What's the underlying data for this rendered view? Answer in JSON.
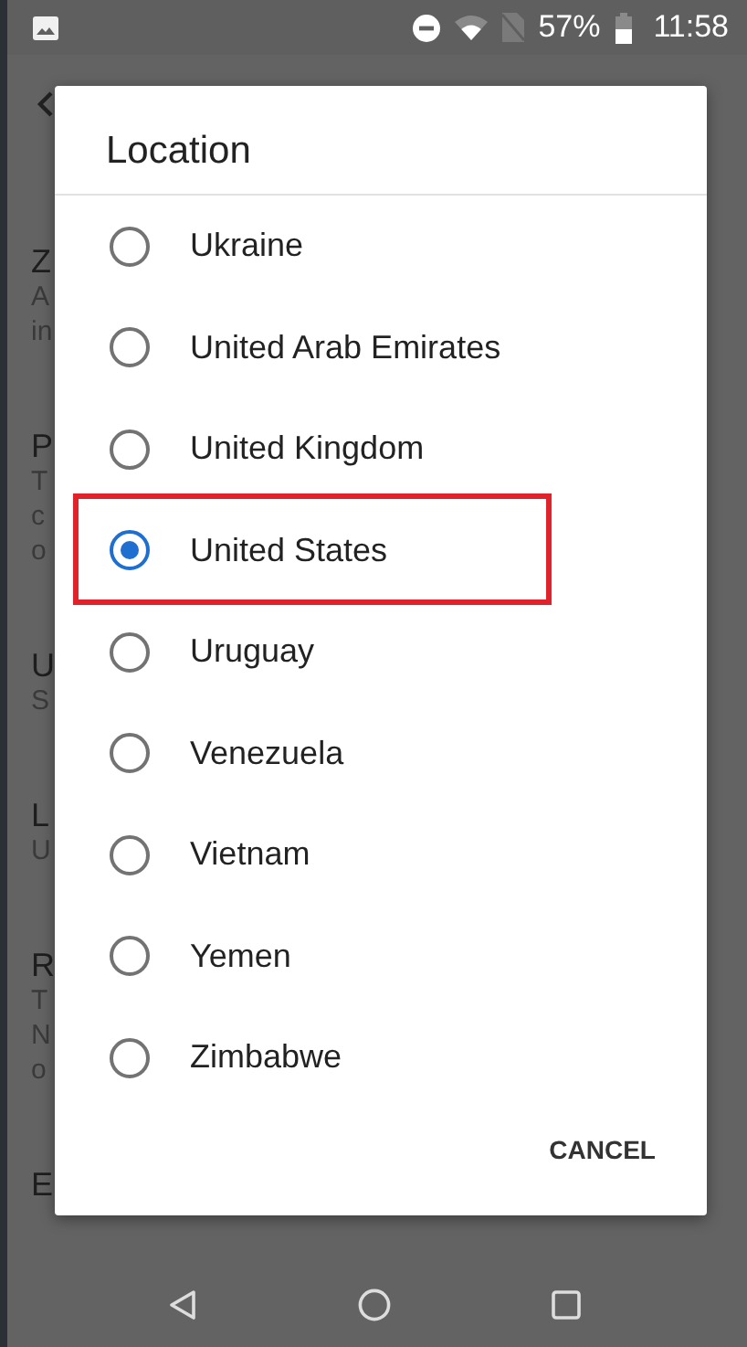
{
  "status_bar": {
    "battery": "57%",
    "time": "11:58"
  },
  "background_list": [
    {
      "title": "Z",
      "lines": [
        "A",
        "in"
      ]
    },
    {
      "title": "P",
      "lines": [
        "T",
        "c",
        "o"
      ]
    },
    {
      "title": "U",
      "lines": [
        "S"
      ]
    },
    {
      "title": "L",
      "lines": [
        "U"
      ]
    },
    {
      "title": "R",
      "lines": [
        "T",
        "N",
        "o"
      ]
    },
    {
      "title": "E"
    }
  ],
  "dialog": {
    "title": "Location",
    "options": [
      {
        "label": "Ukraine",
        "selected": false,
        "highlighted": false
      },
      {
        "label": "United Arab Emirates",
        "selected": false,
        "highlighted": false
      },
      {
        "label": "United Kingdom",
        "selected": false,
        "highlighted": false
      },
      {
        "label": "United States",
        "selected": true,
        "highlighted": true
      },
      {
        "label": "Uruguay",
        "selected": false,
        "highlighted": false
      },
      {
        "label": "Venezuela",
        "selected": false,
        "highlighted": false
      },
      {
        "label": "Vietnam",
        "selected": false,
        "highlighted": false
      },
      {
        "label": "Yemen",
        "selected": false,
        "highlighted": false
      },
      {
        "label": "Zimbabwe",
        "selected": false,
        "highlighted": false
      }
    ],
    "buttons": [
      "CANCEL"
    ]
  }
}
